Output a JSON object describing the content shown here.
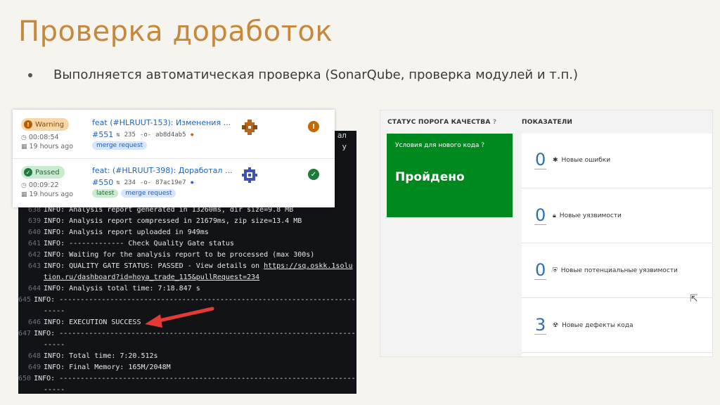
{
  "slide": {
    "title": "Проверка доработок",
    "bullet": "Выполняется автоматическая проверка (SonarQube, проверка модулей и т.п.)"
  },
  "colors": {
    "title": "#c6893b",
    "terminal_bg": "#111317",
    "quality_gate_green": "#00891f",
    "metric_value_blue": "#2f6fb5",
    "arrow_red": "#e53935"
  },
  "pipelines": [
    {
      "status": "Warning",
      "status_icon": "exclamation-icon",
      "duration": "00:08:54",
      "ago": "19 hours ago",
      "title": "feat (#HLRUUT-153): Изменения ...",
      "id": "#551",
      "mr_count": "235",
      "commit": "ab8d4ab5",
      "tags": [
        "merge request"
      ]
    },
    {
      "status": "Passed",
      "status_icon": "check-icon",
      "duration": "00:09:22",
      "ago": "19 hours ago",
      "title": "feat: (#HLRUUT-398): Доработал ...",
      "id": "#550",
      "mr_count": "234",
      "commit": "87ac19e7",
      "tags": [
        "latest",
        "merge request"
      ]
    }
  ],
  "terminal": {
    "top_fragments": [
      "ал",
      "y"
    ],
    "lines": [
      {
        "n": "638",
        "t": "INFO: Analysis report generated in 13260ms, dir size=9.8 MB"
      },
      {
        "n": "639",
        "t": "INFO: Analysis report compressed in 21679ms, zip size=13.4 MB"
      },
      {
        "n": "640",
        "t": "INFO: Analysis report uploaded in 949ms"
      },
      {
        "n": "641",
        "t": "INFO: ------------- Check Quality Gate status"
      },
      {
        "n": "642",
        "t": "INFO: Waiting for the analysis report to be processed (max 300s)"
      },
      {
        "n": "643",
        "t": "INFO: QUALITY GATE STATUS: PASSED - View details on ",
        "link": "https://sq.oskk.1solu"
      },
      {
        "n": "",
        "t": "",
        "link": "tion.ru/dashboard?id=hoya_trade_115&pullRequest=234"
      },
      {
        "n": "644",
        "t": "INFO: Analysis total time: 7:18.847 s"
      },
      {
        "n": "645",
        "t": "INFO: ------------------------------------------------------------------------"
      },
      {
        "n": "",
        "t": "-----"
      },
      {
        "n": "646",
        "t": "INFO: EXECUTION SUCCESS"
      },
      {
        "n": "647",
        "t": "INFO: ------------------------------------------------------------------------"
      },
      {
        "n": "",
        "t": "-----"
      },
      {
        "n": "648",
        "t": "INFO: Total time: 7:20.512s"
      },
      {
        "n": "649",
        "t": "INFO: Final Memory: 165M/2048M"
      },
      {
        "n": "650",
        "t": "INFO: ------------------------------------------------------------------------"
      },
      {
        "n": "",
        "t": "-----"
      }
    ]
  },
  "sonar": {
    "qg_header": "СТАТУС ПОРОГА КАЧЕСТВА",
    "metrics_header": "ПОКАЗАТЕЛИ",
    "qg_subtitle": "Условия для нового кода",
    "qg_value": "Пройдено",
    "metrics": [
      {
        "value": "0",
        "label": "Новые ошибки",
        "icon": "bug-icon"
      },
      {
        "value": "0",
        "label": "Новые уязвимости",
        "icon": "lock-icon"
      },
      {
        "value": "0",
        "label": "Новые потенциальные уязвимости",
        "icon": "shield-icon"
      },
      {
        "value": "3",
        "label": "Новые дефекты кода",
        "icon": "code-smell-icon"
      }
    ]
  }
}
